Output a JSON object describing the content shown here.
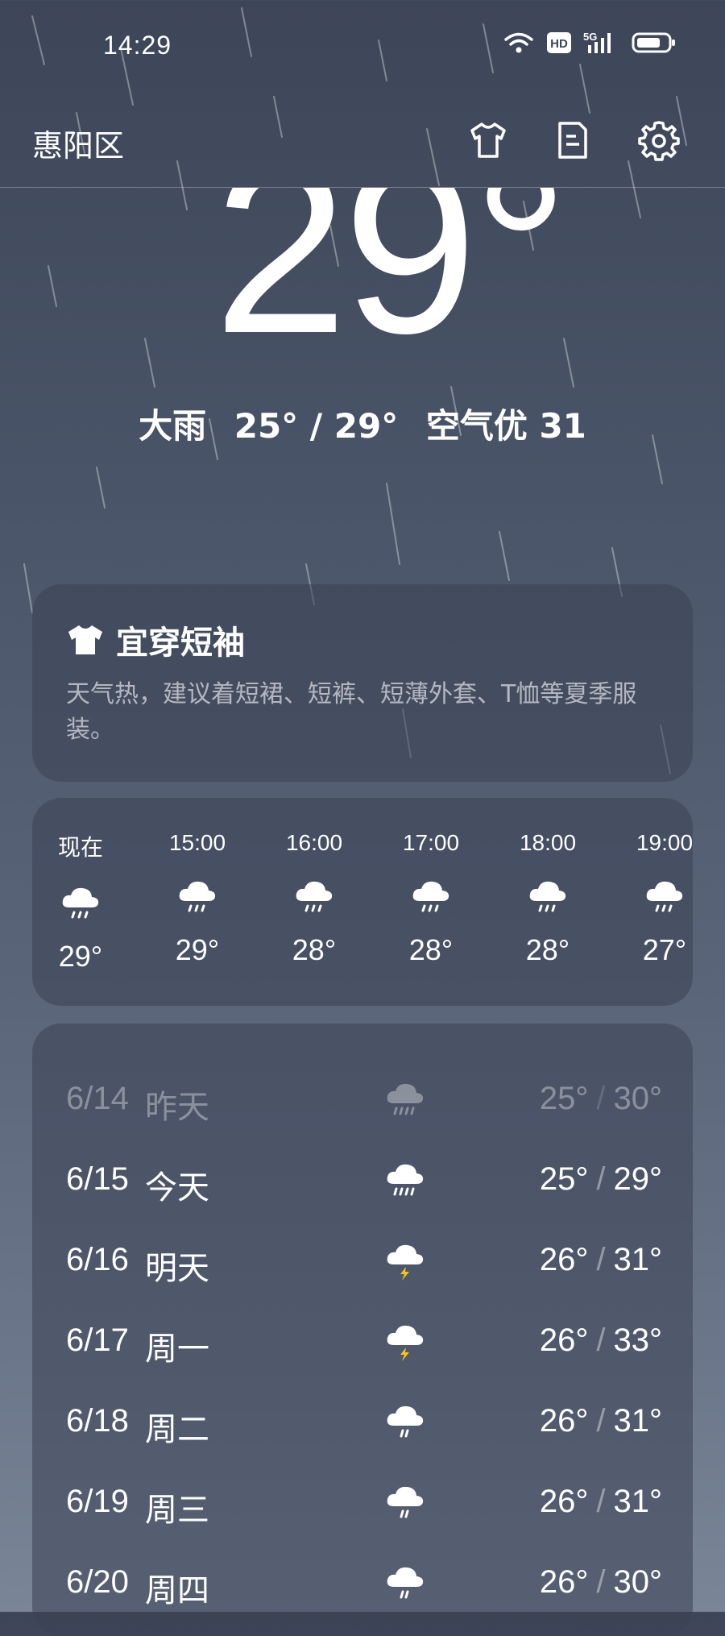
{
  "status_bar": {
    "time": "14:29",
    "hd_label": "HD",
    "network_label": "5G"
  },
  "header": {
    "location": "惠阳区"
  },
  "current": {
    "temp": "29°",
    "condition": "大雨",
    "range": "25° / 29°",
    "aqi": "空气优 31"
  },
  "clothing": {
    "title": "宜穿短袖",
    "description": "天气热，建议着短裙、短裤、短薄外套、T恤等夏季服装。"
  },
  "hourly": [
    {
      "time": "现在",
      "icon": "rain-cloud-icon",
      "temp": "29°"
    },
    {
      "time": "15:00",
      "icon": "rain-cloud-icon",
      "temp": "29°"
    },
    {
      "time": "16:00",
      "icon": "rain-cloud-icon",
      "temp": "28°"
    },
    {
      "time": "17:00",
      "icon": "rain-cloud-icon",
      "temp": "28°"
    },
    {
      "time": "18:00",
      "icon": "rain-cloud-icon",
      "temp": "28°"
    },
    {
      "time": "19:00",
      "icon": "rain-cloud-icon",
      "temp": "27°"
    }
  ],
  "daily": [
    {
      "date": "6/14",
      "name": "昨天",
      "icon": "heavy-rain-icon",
      "low": "25°",
      "high": "30°",
      "past": true
    },
    {
      "date": "6/15",
      "name": "今天",
      "icon": "heavy-rain-icon",
      "low": "25°",
      "high": "29°"
    },
    {
      "date": "6/16",
      "name": "明天",
      "icon": "thunderstorm-icon",
      "low": "26°",
      "high": "31°"
    },
    {
      "date": "6/17",
      "name": "周一",
      "icon": "thunderstorm-icon",
      "low": "26°",
      "high": "33°"
    },
    {
      "date": "6/18",
      "name": "周二",
      "icon": "rain-cloud-icon",
      "low": "26°",
      "high": "31°"
    },
    {
      "date": "6/19",
      "name": "周三",
      "icon": "rain-cloud-icon",
      "low": "26°",
      "high": "31°"
    },
    {
      "date": "6/20",
      "name": "周四",
      "icon": "rain-cloud-icon",
      "low": "26°",
      "high": "30°"
    }
  ],
  "colors": {
    "bolt": "#f5c518",
    "background_top": "#3d4658",
    "background_bottom": "#7a8598"
  }
}
